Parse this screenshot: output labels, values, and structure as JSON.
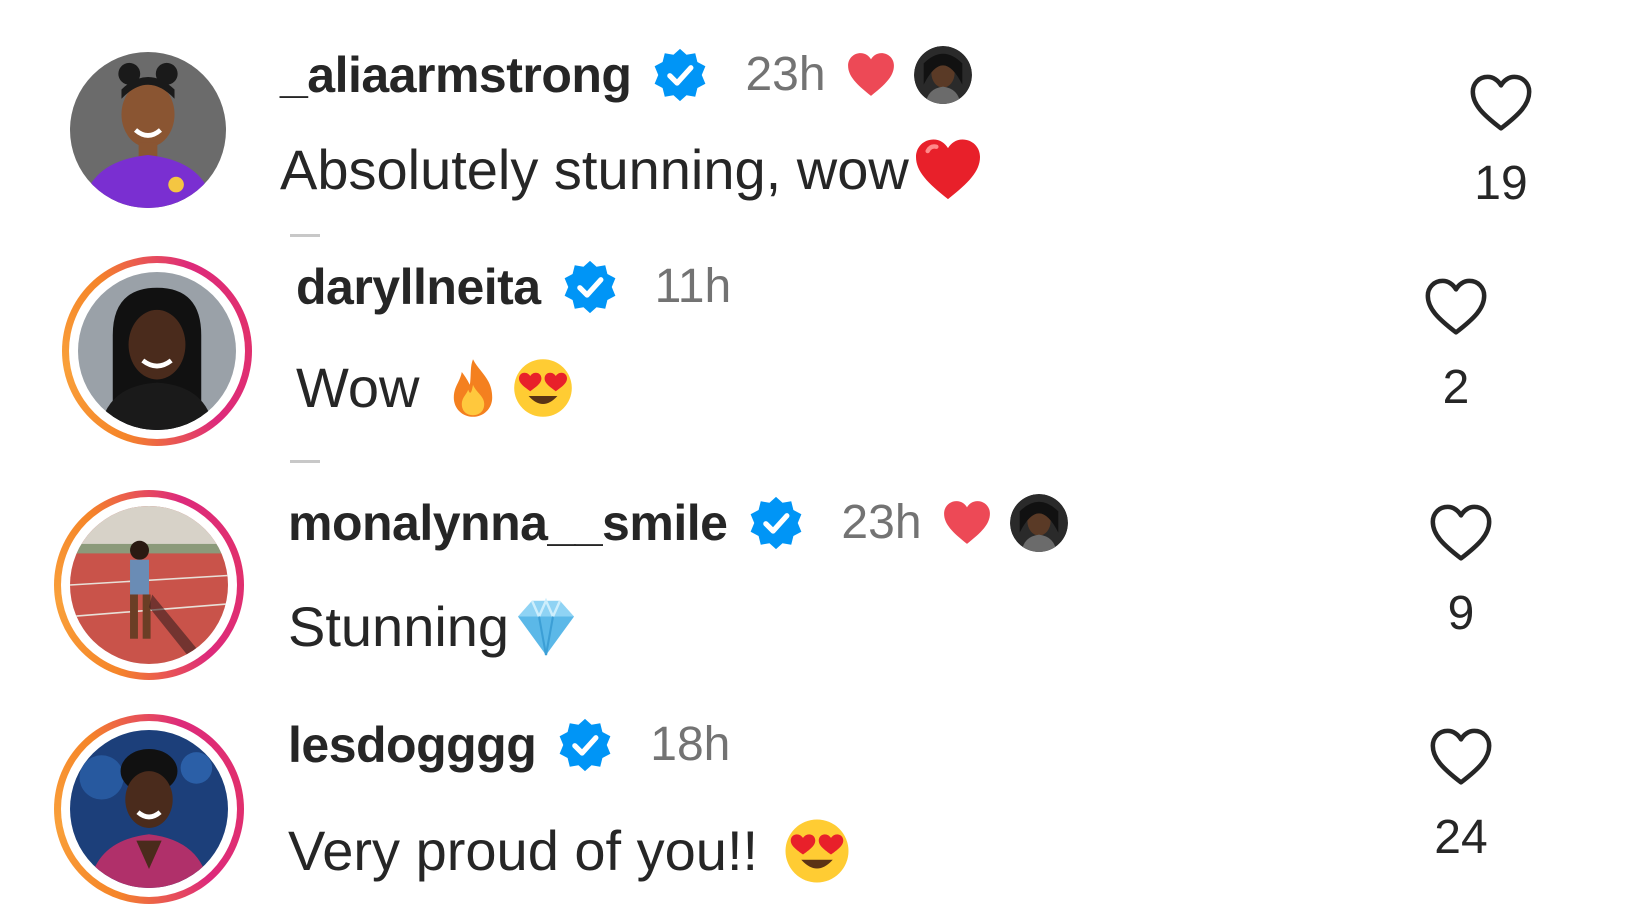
{
  "comments": [
    {
      "username": "_aliaarmstrong",
      "time": "23h",
      "text": "Absolutely stunning, wow",
      "emojis": [
        "red-heart"
      ],
      "liked_by_author": true,
      "likes": "19",
      "avatar_colors": {
        "bg": "#6b6b6b",
        "shirt": "#7a2fd1",
        "skin": "#8a5532"
      }
    },
    {
      "username": "daryllneita",
      "time": "11h",
      "text": "Wow",
      "emojis": [
        "fire",
        "heart-eyes"
      ],
      "liked_by_author": false,
      "likes": "2",
      "avatar_colors": {
        "bg": "#9aa1a8",
        "shirt": "#1a1a1a",
        "skin": "#4a2b1c"
      }
    },
    {
      "username": "monalynna__smile",
      "time": "23h",
      "text": "Stunning",
      "emojis": [
        "gem"
      ],
      "liked_by_author": true,
      "likes": "9",
      "avatar_colors": {
        "bg": "#c9534a",
        "shirt": "#6a8cb5",
        "skin": "#6b3e25"
      }
    },
    {
      "username": "lesdogggg",
      "time": "18h",
      "text": "Very proud of you!!",
      "emojis": [
        "heart-eyes"
      ],
      "liked_by_author": false,
      "likes": "24",
      "avatar_colors": {
        "bg": "#1c3f7a",
        "shirt": "#b0306a",
        "skin": "#4a2b1c"
      }
    }
  ],
  "colors": {
    "verified_blue": "#0095f6",
    "like_red": "#ed4956",
    "muted_text": "#737373",
    "primary_text": "#262626"
  }
}
